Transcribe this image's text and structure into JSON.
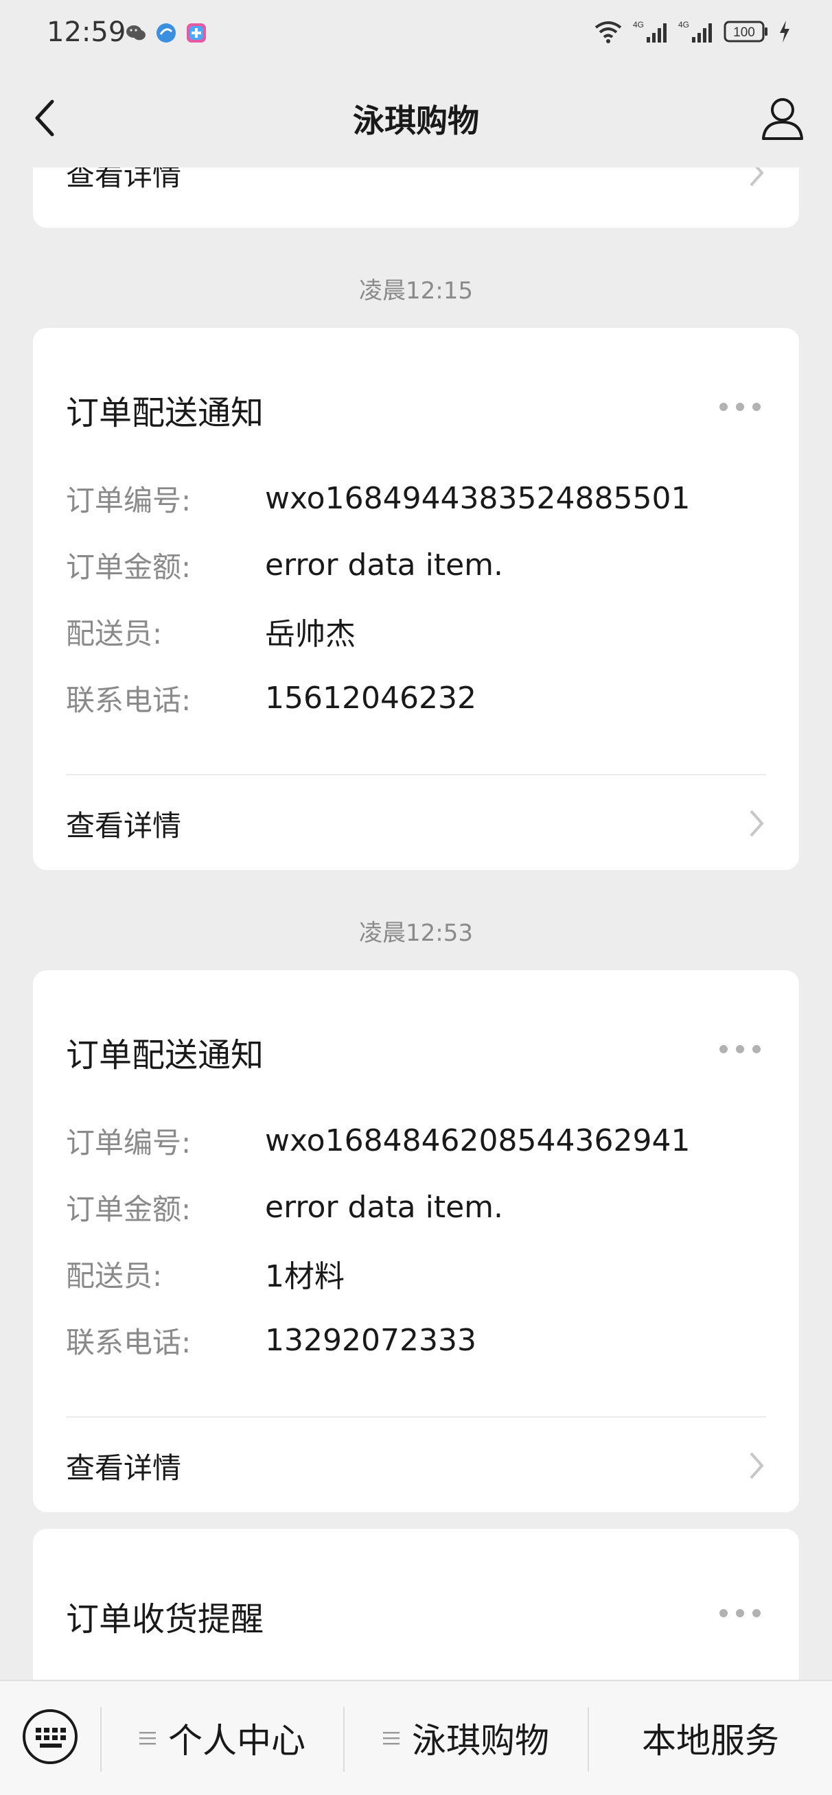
{
  "status_bar": {
    "time": "12:59",
    "battery": "100",
    "network": "4G"
  },
  "nav": {
    "title": "泳琪购物"
  },
  "top_card": {
    "detail_label": "查看详情"
  },
  "messages": [
    {
      "time": "凌晨12:15",
      "title": "订单配送通知",
      "fields": [
        {
          "label": "订单编号:",
          "value": "wxo1684944383524885501"
        },
        {
          "label": "订单金额:",
          "value": "error data item."
        },
        {
          "label": "配送员:",
          "value": "岳帅杰"
        },
        {
          "label": "联系电话:",
          "value": "15612046232"
        }
      ],
      "detail_label": "查看详情"
    },
    {
      "time": "凌晨12:53",
      "title": "订单配送通知",
      "fields": [
        {
          "label": "订单编号:",
          "value": "wxo1684846208544362941"
        },
        {
          "label": "订单金额:",
          "value": "error data item."
        },
        {
          "label": "配送员:",
          "value": "1材料"
        },
        {
          "label": "联系电话:",
          "value": "13292072333"
        }
      ],
      "detail_label": "查看详情"
    },
    {
      "title": "订单收货提醒"
    }
  ],
  "bottom_menu": {
    "items": [
      "个人中心",
      "泳琪购物",
      "本地服务"
    ]
  },
  "colors": {
    "background": "#ededed",
    "card": "#ffffff",
    "label_gray": "#8a8a8a",
    "text": "#191919"
  }
}
